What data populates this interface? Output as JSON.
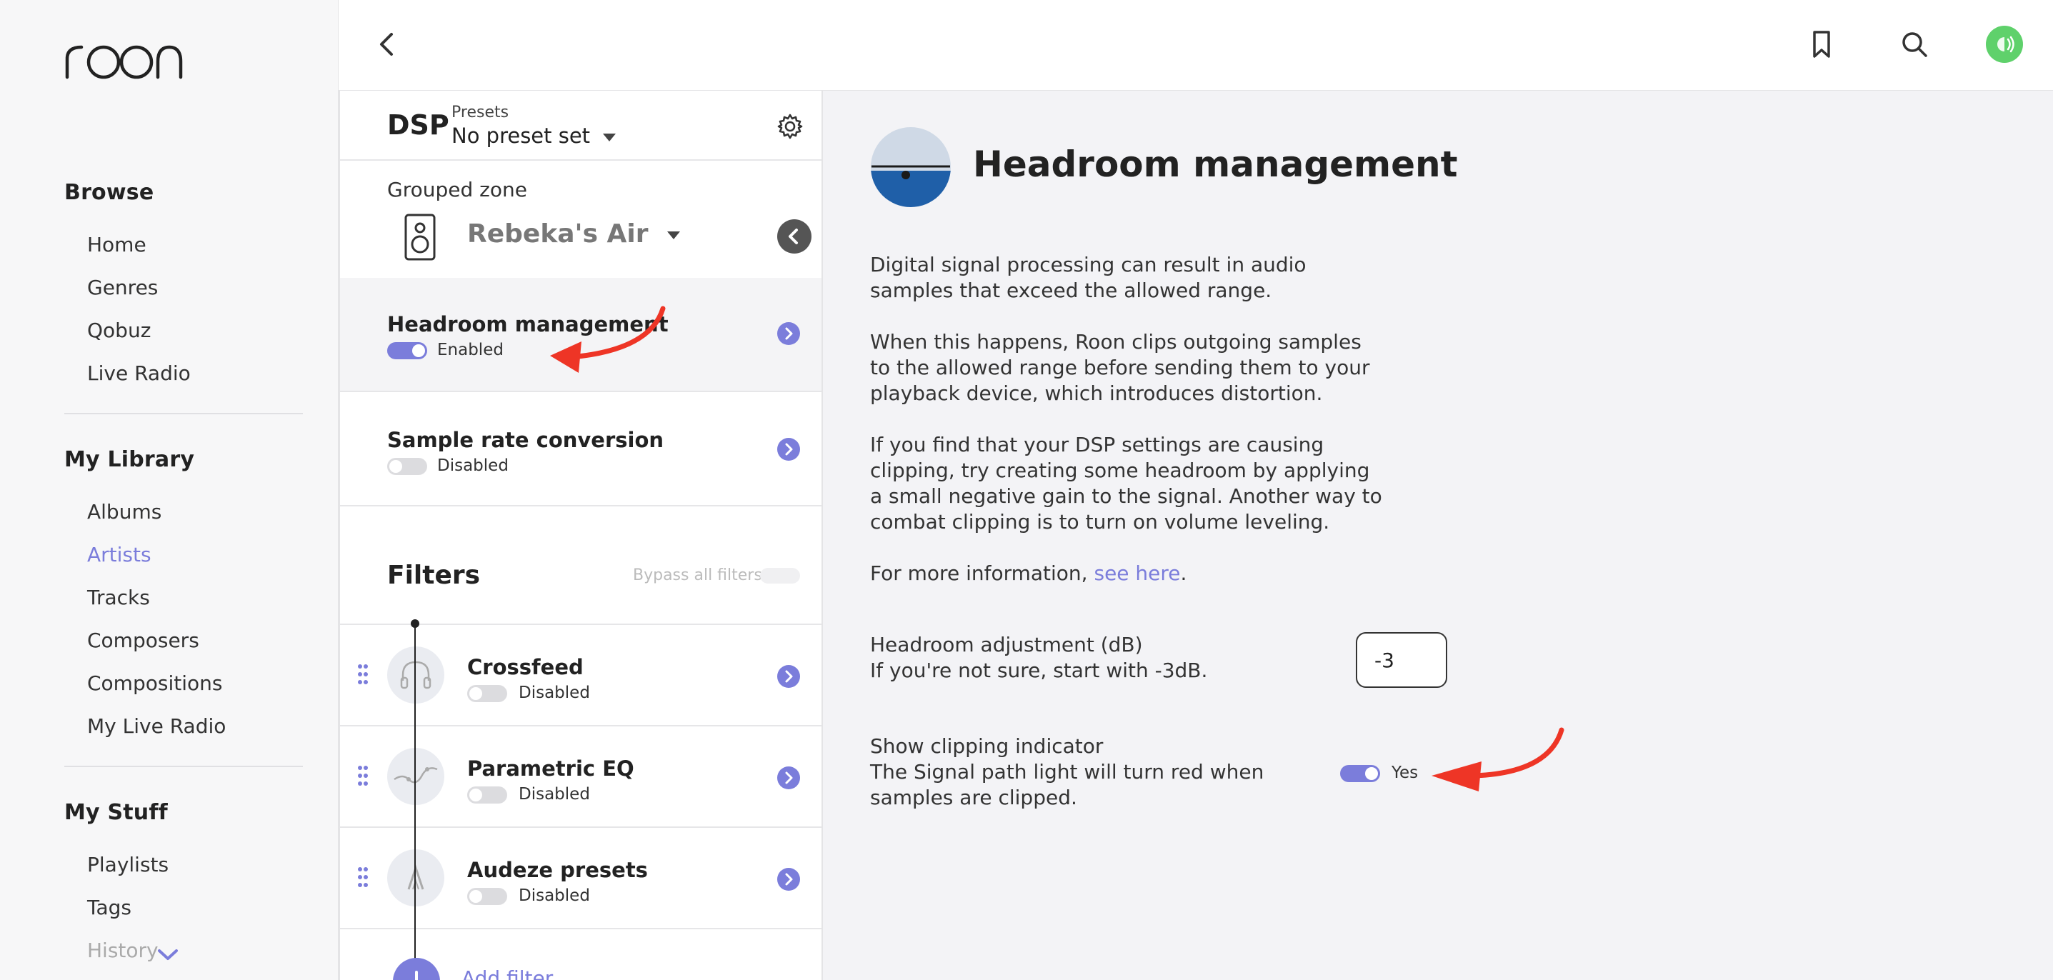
{
  "app": {
    "logo_text": "roon",
    "accent_color": "#7b7ddb",
    "annotation_color": "#ee3526"
  },
  "sidebar": {
    "browse": {
      "title": "Browse",
      "items": [
        {
          "label": "Home"
        },
        {
          "label": "Genres"
        },
        {
          "label": "Qobuz"
        },
        {
          "label": "Live Radio"
        }
      ]
    },
    "library": {
      "title": "My Library",
      "items": [
        {
          "label": "Albums"
        },
        {
          "label": "Artists",
          "active": true
        },
        {
          "label": "Tracks"
        },
        {
          "label": "Composers"
        },
        {
          "label": "Compositions"
        },
        {
          "label": "My Live Radio"
        }
      ]
    },
    "stuff": {
      "title": "My Stuff",
      "items": [
        {
          "label": "Playlists"
        },
        {
          "label": "Tags"
        },
        {
          "label": "History"
        }
      ]
    }
  },
  "topbar": {
    "back_icon": "chevron-left-icon",
    "bookmark_icon": "bookmark-icon",
    "search_icon": "search-icon",
    "avatar_icon": "user-avatar",
    "avatar_color": "#5fd16b"
  },
  "dsp": {
    "title": "DSP",
    "presets_label": "Presets",
    "presets_value": "No preset set",
    "zone_label": "Grouped zone",
    "zone_name": "Rebeka's Air",
    "rows": [
      {
        "title": "Headroom management",
        "status": "Enabled",
        "enabled": true,
        "selected": true
      },
      {
        "title": "Sample rate conversion",
        "status": "Disabled",
        "enabled": false,
        "selected": false
      }
    ],
    "filters_title": "Filters",
    "bypass_label": "Bypass all filters",
    "filters": [
      {
        "title": "Crossfeed",
        "status": "Disabled",
        "icon": "headphones-icon"
      },
      {
        "title": "Parametric EQ",
        "status": "Disabled",
        "icon": "eq-curve-icon"
      },
      {
        "title": "Audeze presets",
        "status": "Disabled",
        "icon": "audeze-logo-icon"
      }
    ],
    "add_filter_label": "Add filter"
  },
  "details": {
    "title": "Headroom management",
    "paragraphs": [
      "Digital signal processing can result in audio samples that exceed the allowed range.",
      "When this happens, Roon clips outgoing samples to the allowed range before sending them to your playback device, which introduces distortion.",
      "If you find that your DSP settings are causing clipping, try creating some headroom by applying a small negative gain to the signal. Another way to combat clipping is to turn on volume leveling."
    ],
    "more_info_prefix": "For more information, ",
    "more_info_link": "see here",
    "more_info_suffix": ".",
    "adjustment_label": "Headroom adjustment (dB)",
    "adjustment_hint": "If you're not sure, start with -3dB.",
    "adjustment_value": "-3",
    "clipping_label": "Show clipping indicator",
    "clipping_hint": "The Signal path light will turn red when samples are clipped.",
    "clipping_value": "Yes"
  }
}
